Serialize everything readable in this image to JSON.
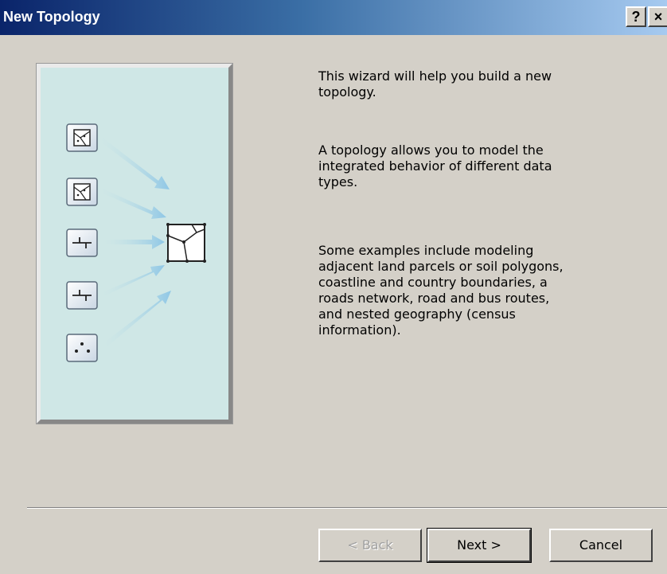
{
  "window": {
    "title": "New Topology",
    "help_button": "?",
    "close_button": "×"
  },
  "content": {
    "paragraph_1": "This wizard will help you build a new\ntopology.",
    "paragraph_2": "A topology allows you to model the\nintegrated behavior of different data\ntypes.",
    "paragraph_3": "Some examples include modeling\nadjacent land parcels or soil polygons,\ncoastline and country boundaries, a\nroads network, road and bus routes,\nand nested geography (census\ninformation)."
  },
  "illustration": {
    "sources": [
      "polygon-icon",
      "polygon-icon",
      "line-icon",
      "line-icon",
      "points-icon"
    ],
    "target": "topology-icon",
    "background_color": "#cfe7e6",
    "arrow_color": "#8fc7e6"
  },
  "buttons": {
    "back": "< Back",
    "next": "Next >",
    "cancel": "Cancel"
  }
}
